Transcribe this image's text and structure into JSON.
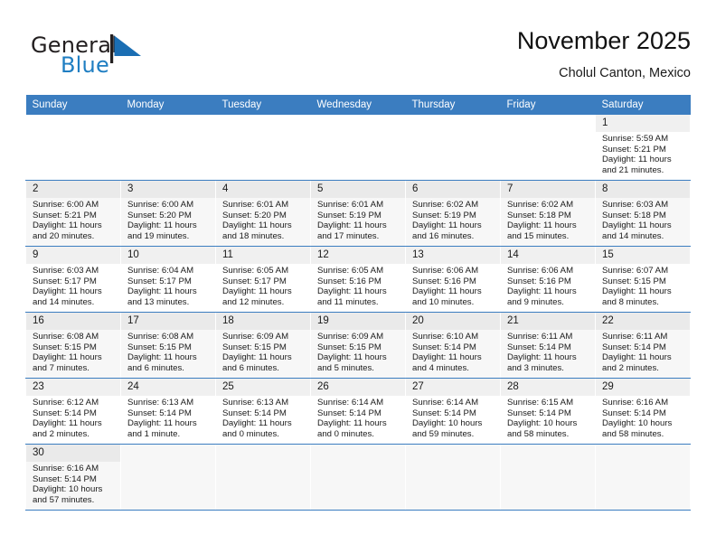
{
  "brand": {
    "name_part1": "General",
    "name_part2": "Blue",
    "flag_icon": "blue-triangle-flag-icon",
    "colors": {
      "dark": "#231f20",
      "blue": "#1f7ec2",
      "header_blue": "#3b7dc0"
    }
  },
  "header": {
    "title": "November 2025",
    "subtitle": "Cholul Canton, Mexico"
  },
  "weekdays": [
    "Sunday",
    "Monday",
    "Tuesday",
    "Wednesday",
    "Thursday",
    "Friday",
    "Saturday"
  ],
  "weeks": [
    [
      {
        "day": "",
        "sunrise": "",
        "sunset": "",
        "daylight1": "",
        "daylight2": ""
      },
      {
        "day": "",
        "sunrise": "",
        "sunset": "",
        "daylight1": "",
        "daylight2": ""
      },
      {
        "day": "",
        "sunrise": "",
        "sunset": "",
        "daylight1": "",
        "daylight2": ""
      },
      {
        "day": "",
        "sunrise": "",
        "sunset": "",
        "daylight1": "",
        "daylight2": ""
      },
      {
        "day": "",
        "sunrise": "",
        "sunset": "",
        "daylight1": "",
        "daylight2": ""
      },
      {
        "day": "",
        "sunrise": "",
        "sunset": "",
        "daylight1": "",
        "daylight2": ""
      },
      {
        "day": "1",
        "sunrise": "Sunrise: 5:59 AM",
        "sunset": "Sunset: 5:21 PM",
        "daylight1": "Daylight: 11 hours",
        "daylight2": "and 21 minutes."
      }
    ],
    [
      {
        "day": "2",
        "sunrise": "Sunrise: 6:00 AM",
        "sunset": "Sunset: 5:21 PM",
        "daylight1": "Daylight: 11 hours",
        "daylight2": "and 20 minutes."
      },
      {
        "day": "3",
        "sunrise": "Sunrise: 6:00 AM",
        "sunset": "Sunset: 5:20 PM",
        "daylight1": "Daylight: 11 hours",
        "daylight2": "and 19 minutes."
      },
      {
        "day": "4",
        "sunrise": "Sunrise: 6:01 AM",
        "sunset": "Sunset: 5:20 PM",
        "daylight1": "Daylight: 11 hours",
        "daylight2": "and 18 minutes."
      },
      {
        "day": "5",
        "sunrise": "Sunrise: 6:01 AM",
        "sunset": "Sunset: 5:19 PM",
        "daylight1": "Daylight: 11 hours",
        "daylight2": "and 17 minutes."
      },
      {
        "day": "6",
        "sunrise": "Sunrise: 6:02 AM",
        "sunset": "Sunset: 5:19 PM",
        "daylight1": "Daylight: 11 hours",
        "daylight2": "and 16 minutes."
      },
      {
        "day": "7",
        "sunrise": "Sunrise: 6:02 AM",
        "sunset": "Sunset: 5:18 PM",
        "daylight1": "Daylight: 11 hours",
        "daylight2": "and 15 minutes."
      },
      {
        "day": "8",
        "sunrise": "Sunrise: 6:03 AM",
        "sunset": "Sunset: 5:18 PM",
        "daylight1": "Daylight: 11 hours",
        "daylight2": "and 14 minutes."
      }
    ],
    [
      {
        "day": "9",
        "sunrise": "Sunrise: 6:03 AM",
        "sunset": "Sunset: 5:17 PM",
        "daylight1": "Daylight: 11 hours",
        "daylight2": "and 14 minutes."
      },
      {
        "day": "10",
        "sunrise": "Sunrise: 6:04 AM",
        "sunset": "Sunset: 5:17 PM",
        "daylight1": "Daylight: 11 hours",
        "daylight2": "and 13 minutes."
      },
      {
        "day": "11",
        "sunrise": "Sunrise: 6:05 AM",
        "sunset": "Sunset: 5:17 PM",
        "daylight1": "Daylight: 11 hours",
        "daylight2": "and 12 minutes."
      },
      {
        "day": "12",
        "sunrise": "Sunrise: 6:05 AM",
        "sunset": "Sunset: 5:16 PM",
        "daylight1": "Daylight: 11 hours",
        "daylight2": "and 11 minutes."
      },
      {
        "day": "13",
        "sunrise": "Sunrise: 6:06 AM",
        "sunset": "Sunset: 5:16 PM",
        "daylight1": "Daylight: 11 hours",
        "daylight2": "and 10 minutes."
      },
      {
        "day": "14",
        "sunrise": "Sunrise: 6:06 AM",
        "sunset": "Sunset: 5:16 PM",
        "daylight1": "Daylight: 11 hours",
        "daylight2": "and 9 minutes."
      },
      {
        "day": "15",
        "sunrise": "Sunrise: 6:07 AM",
        "sunset": "Sunset: 5:15 PM",
        "daylight1": "Daylight: 11 hours",
        "daylight2": "and 8 minutes."
      }
    ],
    [
      {
        "day": "16",
        "sunrise": "Sunrise: 6:08 AM",
        "sunset": "Sunset: 5:15 PM",
        "daylight1": "Daylight: 11 hours",
        "daylight2": "and 7 minutes."
      },
      {
        "day": "17",
        "sunrise": "Sunrise: 6:08 AM",
        "sunset": "Sunset: 5:15 PM",
        "daylight1": "Daylight: 11 hours",
        "daylight2": "and 6 minutes."
      },
      {
        "day": "18",
        "sunrise": "Sunrise: 6:09 AM",
        "sunset": "Sunset: 5:15 PM",
        "daylight1": "Daylight: 11 hours",
        "daylight2": "and 6 minutes."
      },
      {
        "day": "19",
        "sunrise": "Sunrise: 6:09 AM",
        "sunset": "Sunset: 5:15 PM",
        "daylight1": "Daylight: 11 hours",
        "daylight2": "and 5 minutes."
      },
      {
        "day": "20",
        "sunrise": "Sunrise: 6:10 AM",
        "sunset": "Sunset: 5:14 PM",
        "daylight1": "Daylight: 11 hours",
        "daylight2": "and 4 minutes."
      },
      {
        "day": "21",
        "sunrise": "Sunrise: 6:11 AM",
        "sunset": "Sunset: 5:14 PM",
        "daylight1": "Daylight: 11 hours",
        "daylight2": "and 3 minutes."
      },
      {
        "day": "22",
        "sunrise": "Sunrise: 6:11 AM",
        "sunset": "Sunset: 5:14 PM",
        "daylight1": "Daylight: 11 hours",
        "daylight2": "and 2 minutes."
      }
    ],
    [
      {
        "day": "23",
        "sunrise": "Sunrise: 6:12 AM",
        "sunset": "Sunset: 5:14 PM",
        "daylight1": "Daylight: 11 hours",
        "daylight2": "and 2 minutes."
      },
      {
        "day": "24",
        "sunrise": "Sunrise: 6:13 AM",
        "sunset": "Sunset: 5:14 PM",
        "daylight1": "Daylight: 11 hours",
        "daylight2": "and 1 minute."
      },
      {
        "day": "25",
        "sunrise": "Sunrise: 6:13 AM",
        "sunset": "Sunset: 5:14 PM",
        "daylight1": "Daylight: 11 hours",
        "daylight2": "and 0 minutes."
      },
      {
        "day": "26",
        "sunrise": "Sunrise: 6:14 AM",
        "sunset": "Sunset: 5:14 PM",
        "daylight1": "Daylight: 11 hours",
        "daylight2": "and 0 minutes."
      },
      {
        "day": "27",
        "sunrise": "Sunrise: 6:14 AM",
        "sunset": "Sunset: 5:14 PM",
        "daylight1": "Daylight: 10 hours",
        "daylight2": "and 59 minutes."
      },
      {
        "day": "28",
        "sunrise": "Sunrise: 6:15 AM",
        "sunset": "Sunset: 5:14 PM",
        "daylight1": "Daylight: 10 hours",
        "daylight2": "and 58 minutes."
      },
      {
        "day": "29",
        "sunrise": "Sunrise: 6:16 AM",
        "sunset": "Sunset: 5:14 PM",
        "daylight1": "Daylight: 10 hours",
        "daylight2": "and 58 minutes."
      }
    ],
    [
      {
        "day": "30",
        "sunrise": "Sunrise: 6:16 AM",
        "sunset": "Sunset: 5:14 PM",
        "daylight1": "Daylight: 10 hours",
        "daylight2": "and 57 minutes."
      },
      {
        "day": "",
        "sunrise": "",
        "sunset": "",
        "daylight1": "",
        "daylight2": ""
      },
      {
        "day": "",
        "sunrise": "",
        "sunset": "",
        "daylight1": "",
        "daylight2": ""
      },
      {
        "day": "",
        "sunrise": "",
        "sunset": "",
        "daylight1": "",
        "daylight2": ""
      },
      {
        "day": "",
        "sunrise": "",
        "sunset": "",
        "daylight1": "",
        "daylight2": ""
      },
      {
        "day": "",
        "sunrise": "",
        "sunset": "",
        "daylight1": "",
        "daylight2": ""
      },
      {
        "day": "",
        "sunrise": "",
        "sunset": "",
        "daylight1": "",
        "daylight2": ""
      }
    ]
  ]
}
